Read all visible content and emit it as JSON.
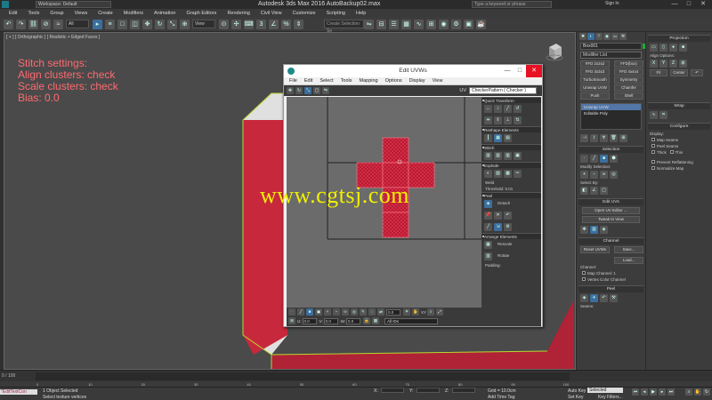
{
  "titlebar": {
    "workspace": "Workspace: Default",
    "title": "Autodesk 3ds Max 2016    AutoBackup02.max",
    "search_placeholder": "Type a keyword or phrase",
    "sign_in": "Sign In",
    "minimize": "—",
    "maximize": "□",
    "close": "✕"
  },
  "menubar": {
    "items": [
      "Edit",
      "Tools",
      "Group",
      "Views",
      "Create",
      "Modifiers",
      "Animation",
      "Graph Editors",
      "Rendering",
      "Civil View",
      "Customize",
      "Scripting",
      "Help"
    ]
  },
  "toolbar": {
    "filter": "All",
    "view": "View",
    "selection_set": "Create Selection Se"
  },
  "viewport": {
    "label": "[ + ] [ Orthographic ] [ Realistic + Edged Faces ]",
    "stitch_lines": [
      "Stitch settings:",
      "Align clusters: check",
      "Scale clusters: check",
      "Bias: 0.0"
    ]
  },
  "uvw_editor": {
    "title": "Edit UVWs",
    "minimize": "—",
    "maximize": "□",
    "close": "✕",
    "menu": [
      "File",
      "Edit",
      "Select",
      "Tools",
      "Mapping",
      "Options",
      "Display",
      "View"
    ],
    "uv_label": "UV",
    "checker": "CheckerPattern  ( Checker )",
    "panel": {
      "quick_transform": "Quick Transform",
      "reshape": "Reshape Elements",
      "stitch": "Stitch",
      "explode": "Explode",
      "weld": "Weld",
      "threshold": "Threshold:",
      "threshold_value": "0.01",
      "peel": "Peel",
      "detach": "Detach",
      "arrange": "Arrange Elements",
      "rescale": "Rescale",
      "rotate": "Rotate",
      "padding": "Padding:"
    },
    "bottom": {
      "u_label": "U:",
      "u_value": "0.0",
      "v_label": "V:",
      "v_value": "0.0",
      "w_label": "W:",
      "w_value": "0.0",
      "spin_value": "0.0",
      "xy_label": "XY",
      "all_ids": "All IDs"
    }
  },
  "watermark": "www.cgtsj.com",
  "command_panel": {
    "object_name": "Box001",
    "modifier_list": "Modifier List",
    "buttons": [
      "FFD 2x2x2",
      "FFD(box)",
      "FFD 3x3x3",
      "FFD 4x4x4",
      "TurboSmooth",
      "Symmetry",
      "Unwrap UVW",
      "Chamfer",
      "Push",
      "Shell"
    ],
    "stack": [
      "Unwrap UVW",
      "Editable Poly"
    ],
    "selection": "Selection",
    "modify_selection": "Modify Selection:",
    "select_by": "Select By:",
    "edit_uvs": "Edit UVs",
    "open_uv_editor": "Open UV Editor ...",
    "tweak_in_view": "Tweak In View",
    "channel": "Channel",
    "reset_uvws": "Reset UVWs",
    "save": "Save...",
    "load": "Load...",
    "channel_label": "Channel:",
    "map_channel": "Map Channel:",
    "map_channel_value": "1",
    "vertex_color": "Vertex Color Channel",
    "peel": "Peel",
    "seams": "Seams:"
  },
  "far_panel": {
    "projection": "Projection",
    "align_options": "Align Options:",
    "x": "X",
    "y": "Y",
    "z": "Z",
    "fit": "Fit",
    "center": "Center",
    "wrap": "Wrap",
    "configure": "Configure",
    "display": "Display:",
    "map_seams": "Map Seams",
    "peel_seams": "Peel Seams",
    "thick": "Thick",
    "thin": "Thin",
    "prevent_reflattening": "Prevent Reflattening",
    "normalize_map": "Normalize Map"
  },
  "timeline": {
    "frame": "0 / 100",
    "ticks": [
      "0",
      "10",
      "20",
      "30",
      "40",
      "50",
      "60",
      "70",
      "80",
      "90",
      "100"
    ]
  },
  "status": {
    "maxscript": "\"EditTextCon",
    "objects": "1 Object Selected",
    "prompt": "Select texture vertices",
    "x_label": "X:",
    "y_label": "Y:",
    "z_label": "Z:",
    "grid": "Grid = 10.0cm",
    "add_time_tag": "Add Time Tag",
    "auto_key": "Auto Key",
    "selected": "Selected",
    "set_key": "Set Key",
    "key_filters": "Key Filters..."
  },
  "colors": {
    "box_red": "#c8283c",
    "uv_red": "#d42c44",
    "stitch_text": "#ff6a70",
    "watermark": "#f0f000",
    "selection_edge": "#b8d830"
  }
}
